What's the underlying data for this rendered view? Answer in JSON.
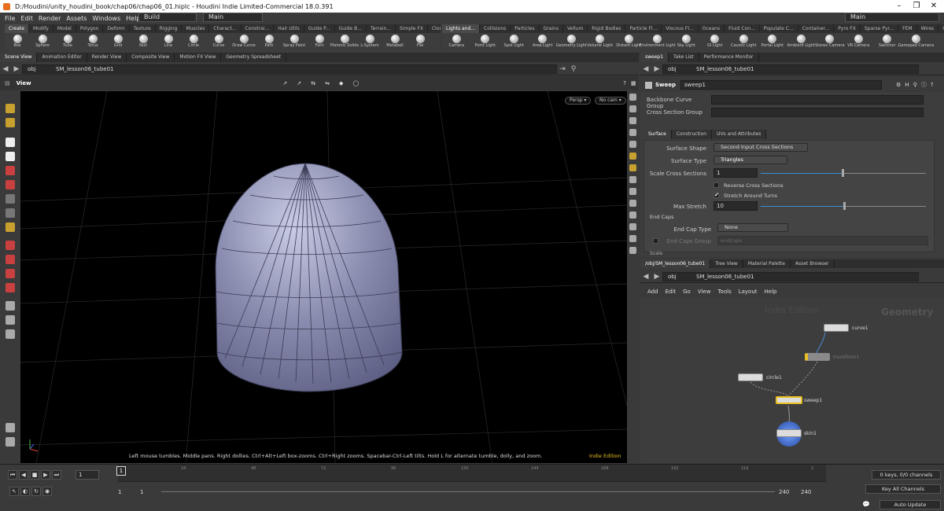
{
  "window": {
    "title": "D:/Houdini/unity_houdini_book/chap06/chap06_01.hiplc - Houdini Indie Limited-Commercial 18.0.391"
  },
  "menu": [
    "File",
    "Edit",
    "Render",
    "Assets",
    "Windows",
    "Help"
  ],
  "desktop": "Build",
  "main_dropdown": "Main",
  "main_right": "Main",
  "shelf_tabs_left": [
    "Create",
    "Modify",
    "Model",
    "Polygon",
    "Deform",
    "Texture",
    "Rigging",
    "Muscles",
    "Charact...",
    "Constrai...",
    "Hair Utils",
    "Guide P...",
    "Guide B...",
    "Terrain...",
    "Simple FX",
    "Cloud FX",
    "Volume"
  ],
  "shelf_tabs_right": [
    "Lights and...",
    "Collisions",
    "Particles",
    "Grains",
    "Vellum",
    "Rigid Bodies",
    "Particle Fl...",
    "Viscous Fl...",
    "Oceans",
    "Fluid Con...",
    "Populate C...",
    "Container...",
    "Pyro FX",
    "Sparse Pyr...",
    "FEM",
    "Wires",
    "Crowds",
    "Drive Sim..."
  ],
  "tools_left": [
    "Box",
    "Sphere",
    "Tube",
    "Torus",
    "Grid",
    "Null",
    "Line",
    "Circle",
    "Curve",
    "Draw Curve",
    "Path",
    "Spray Paint",
    "Font",
    "Platonic Solids",
    "L-System",
    "Metaball",
    "File"
  ],
  "tools_right": [
    "Camera",
    "Point Light",
    "Spot Light",
    "Area Light",
    "Geometry Light",
    "Volume Light",
    "Distant Light",
    "Environment Light",
    "Sky Light",
    "GI Light",
    "Caustic Light",
    "Portal Light",
    "Ambient Light",
    "Stereo Camera",
    "VR Camera",
    "Switcher",
    "Gamepad Camera"
  ],
  "left_panel_tabs": [
    "Scene View",
    "Animation Editor",
    "Render View",
    "Composite View",
    "Motion FX View",
    "Geometry Spreadsheet"
  ],
  "right_panel_tabs": [
    "sweep1",
    "Take List",
    "Performance Monitor"
  ],
  "path": {
    "context": "obj",
    "node": "SM_lesson06_tube01"
  },
  "viewport": {
    "label": "View",
    "persp": "Persp",
    "cam": "No cam",
    "help": "Left mouse tumbles. Middle pans. Right dollies. Ctrl+Alt+Left box-zooms. Ctrl+Right zooms. Spacebar-Ctrl-Left tilts. Hold L for alternate tumble, dolly, and zoom.",
    "edition": "Indie Edition"
  },
  "params": {
    "node_type": "Sweep",
    "node_name": "sweep1",
    "backbone_label": "Backbone Curve Group",
    "cross_label": "Cross Section Group",
    "tabs": [
      "Surface",
      "Construction",
      "UVs and Attributes"
    ],
    "surface_shape_label": "Surface Shape",
    "surface_shape": "Second Input Cross Sections",
    "surface_type_label": "Surface Type",
    "surface_type": "Triangles",
    "scale_label": "Scale Cross Sections",
    "scale": "1",
    "scale_fraction": 0.49,
    "reverse_label": "Reverse Cross Sections",
    "stretch_turns_label": "Stretch Around Turns",
    "max_stretch_label": "Max Stretch",
    "max_stretch": "10",
    "max_stretch_fraction": 0.5,
    "end_caps_label": "End Caps",
    "end_cap_type_label": "End Cap Type",
    "end_cap_type": "None",
    "end_caps_group_label": "End Caps Group",
    "end_caps_group_ph": "endcaps",
    "scale_section": "Scale"
  },
  "network": {
    "tabs": [
      "/obj/SM_lesson06_tube01",
      "Tree View",
      "Material Palette",
      "Asset Browser"
    ],
    "menu": [
      "Add",
      "Edit",
      "Go",
      "View",
      "Tools",
      "Layout",
      "Help"
    ],
    "watermark": "Indie Edition",
    "context_label": "Geometry",
    "nodes": [
      "curve1",
      "transform1",
      "circle1",
      "sweep1",
      "skin1"
    ]
  },
  "timeline": {
    "ticks": [
      "24",
      "48",
      "72",
      "96",
      "120",
      "144",
      "168",
      "192",
      "216",
      "2"
    ],
    "frame": "1",
    "marker": "1",
    "start": "1",
    "start2": "1",
    "end": "240",
    "end2": "240",
    "keys": "0 keys, 0/0 channels",
    "key_all": "Key All Channels",
    "auto_update": "Auto Update"
  }
}
